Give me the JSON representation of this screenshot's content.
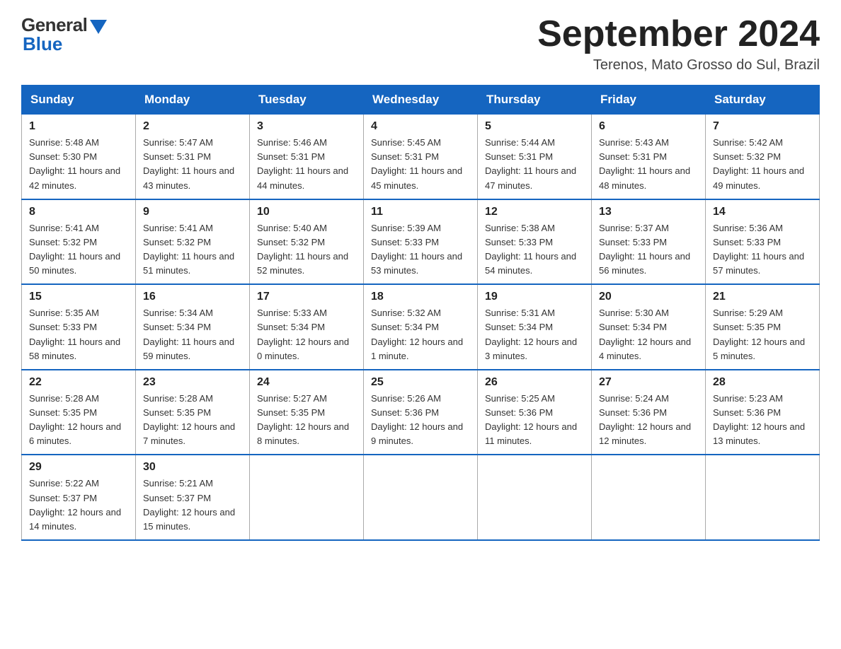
{
  "header": {
    "logo_general": "General",
    "logo_blue": "Blue",
    "month_title": "September 2024",
    "location": "Terenos, Mato Grosso do Sul, Brazil"
  },
  "weekdays": [
    "Sunday",
    "Monday",
    "Tuesday",
    "Wednesday",
    "Thursday",
    "Friday",
    "Saturday"
  ],
  "weeks": [
    [
      {
        "day": "1",
        "sunrise": "5:48 AM",
        "sunset": "5:30 PM",
        "daylight": "11 hours and 42 minutes."
      },
      {
        "day": "2",
        "sunrise": "5:47 AM",
        "sunset": "5:31 PM",
        "daylight": "11 hours and 43 minutes."
      },
      {
        "day": "3",
        "sunrise": "5:46 AM",
        "sunset": "5:31 PM",
        "daylight": "11 hours and 44 minutes."
      },
      {
        "day": "4",
        "sunrise": "5:45 AM",
        "sunset": "5:31 PM",
        "daylight": "11 hours and 45 minutes."
      },
      {
        "day": "5",
        "sunrise": "5:44 AM",
        "sunset": "5:31 PM",
        "daylight": "11 hours and 47 minutes."
      },
      {
        "day": "6",
        "sunrise": "5:43 AM",
        "sunset": "5:31 PM",
        "daylight": "11 hours and 48 minutes."
      },
      {
        "day": "7",
        "sunrise": "5:42 AM",
        "sunset": "5:32 PM",
        "daylight": "11 hours and 49 minutes."
      }
    ],
    [
      {
        "day": "8",
        "sunrise": "5:41 AM",
        "sunset": "5:32 PM",
        "daylight": "11 hours and 50 minutes."
      },
      {
        "day": "9",
        "sunrise": "5:41 AM",
        "sunset": "5:32 PM",
        "daylight": "11 hours and 51 minutes."
      },
      {
        "day": "10",
        "sunrise": "5:40 AM",
        "sunset": "5:32 PM",
        "daylight": "11 hours and 52 minutes."
      },
      {
        "day": "11",
        "sunrise": "5:39 AM",
        "sunset": "5:33 PM",
        "daylight": "11 hours and 53 minutes."
      },
      {
        "day": "12",
        "sunrise": "5:38 AM",
        "sunset": "5:33 PM",
        "daylight": "11 hours and 54 minutes."
      },
      {
        "day": "13",
        "sunrise": "5:37 AM",
        "sunset": "5:33 PM",
        "daylight": "11 hours and 56 minutes."
      },
      {
        "day": "14",
        "sunrise": "5:36 AM",
        "sunset": "5:33 PM",
        "daylight": "11 hours and 57 minutes."
      }
    ],
    [
      {
        "day": "15",
        "sunrise": "5:35 AM",
        "sunset": "5:33 PM",
        "daylight": "11 hours and 58 minutes."
      },
      {
        "day": "16",
        "sunrise": "5:34 AM",
        "sunset": "5:34 PM",
        "daylight": "11 hours and 59 minutes."
      },
      {
        "day": "17",
        "sunrise": "5:33 AM",
        "sunset": "5:34 PM",
        "daylight": "12 hours and 0 minutes."
      },
      {
        "day": "18",
        "sunrise": "5:32 AM",
        "sunset": "5:34 PM",
        "daylight": "12 hours and 1 minute."
      },
      {
        "day": "19",
        "sunrise": "5:31 AM",
        "sunset": "5:34 PM",
        "daylight": "12 hours and 3 minutes."
      },
      {
        "day": "20",
        "sunrise": "5:30 AM",
        "sunset": "5:34 PM",
        "daylight": "12 hours and 4 minutes."
      },
      {
        "day": "21",
        "sunrise": "5:29 AM",
        "sunset": "5:35 PM",
        "daylight": "12 hours and 5 minutes."
      }
    ],
    [
      {
        "day": "22",
        "sunrise": "5:28 AM",
        "sunset": "5:35 PM",
        "daylight": "12 hours and 6 minutes."
      },
      {
        "day": "23",
        "sunrise": "5:28 AM",
        "sunset": "5:35 PM",
        "daylight": "12 hours and 7 minutes."
      },
      {
        "day": "24",
        "sunrise": "5:27 AM",
        "sunset": "5:35 PM",
        "daylight": "12 hours and 8 minutes."
      },
      {
        "day": "25",
        "sunrise": "5:26 AM",
        "sunset": "5:36 PM",
        "daylight": "12 hours and 9 minutes."
      },
      {
        "day": "26",
        "sunrise": "5:25 AM",
        "sunset": "5:36 PM",
        "daylight": "12 hours and 11 minutes."
      },
      {
        "day": "27",
        "sunrise": "5:24 AM",
        "sunset": "5:36 PM",
        "daylight": "12 hours and 12 minutes."
      },
      {
        "day": "28",
        "sunrise": "5:23 AM",
        "sunset": "5:36 PM",
        "daylight": "12 hours and 13 minutes."
      }
    ],
    [
      {
        "day": "29",
        "sunrise": "5:22 AM",
        "sunset": "5:37 PM",
        "daylight": "12 hours and 14 minutes."
      },
      {
        "day": "30",
        "sunrise": "5:21 AM",
        "sunset": "5:37 PM",
        "daylight": "12 hours and 15 minutes."
      },
      null,
      null,
      null,
      null,
      null
    ]
  ]
}
